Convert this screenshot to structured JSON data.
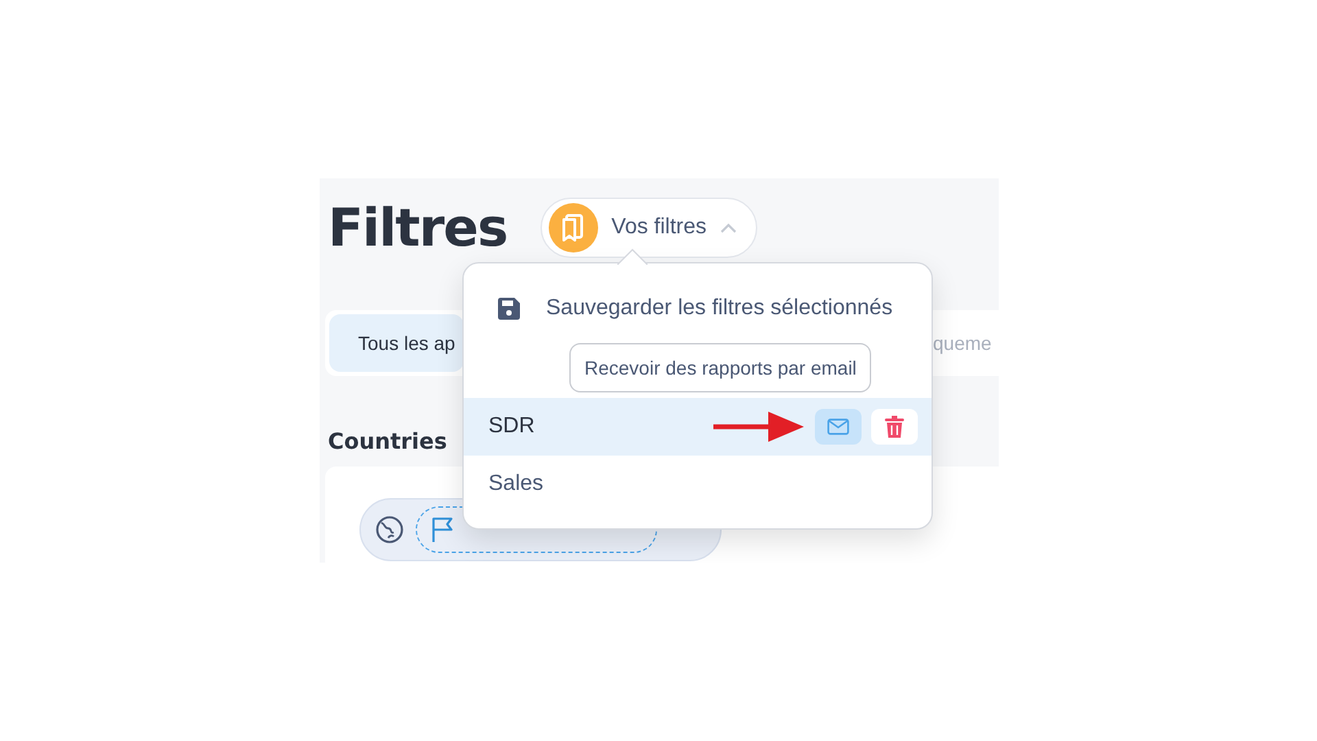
{
  "title": "Filtres",
  "filters_button": {
    "label": "Vos filtres",
    "expanded": true
  },
  "tabs": [
    {
      "label": "Tous les ap",
      "selected": true
    },
    {
      "label": "queme",
      "selected": false
    }
  ],
  "section": {
    "title": "Countries"
  },
  "menu": {
    "save_label": "Sauvegarder les filtres sélectionnés",
    "tooltip": "Recevoir des rapports par email",
    "saved_filters": [
      {
        "name": "SDR",
        "selected": true
      },
      {
        "name": "Sales",
        "selected": false
      }
    ]
  }
}
